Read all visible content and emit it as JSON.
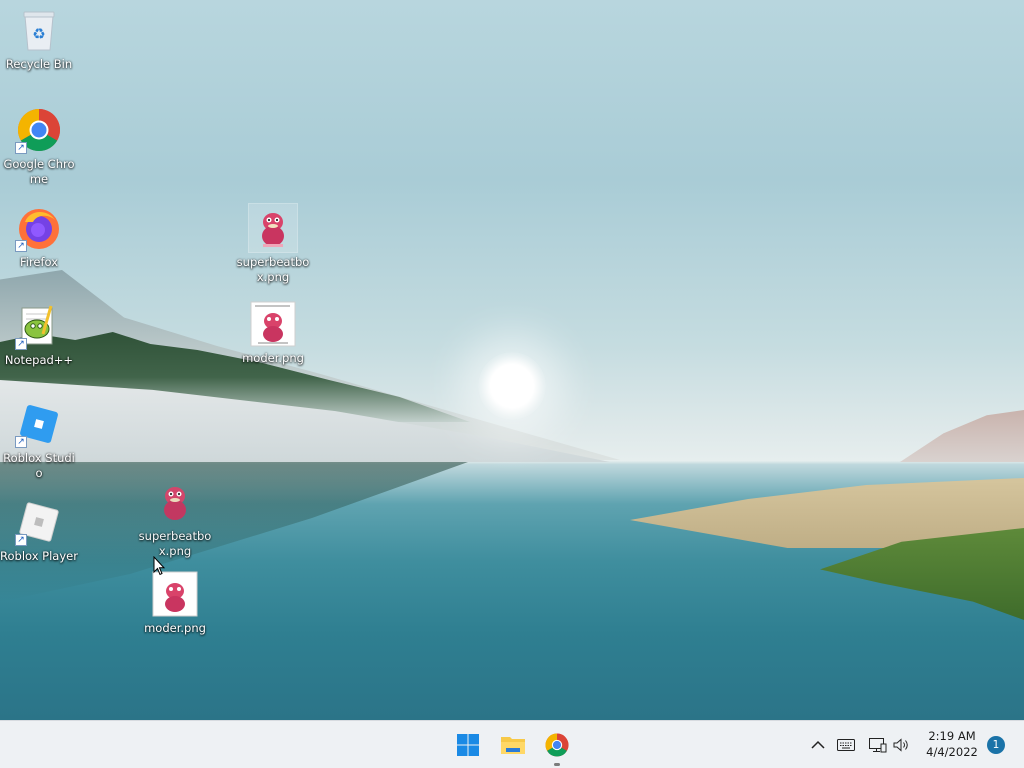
{
  "desktop": {
    "icons": [
      {
        "label": "Recycle Bin",
        "icon": "recycle-bin-icon"
      },
      {
        "label": "Google Chrome",
        "icon": "chrome-icon",
        "shortcut": true
      },
      {
        "label": "Firefox",
        "icon": "firefox-icon",
        "shortcut": true
      },
      {
        "label": "Notepad++",
        "icon": "notepad-plus-plus-icon",
        "shortcut": true
      },
      {
        "label": "Roblox Studio",
        "icon": "roblox-studio-icon",
        "shortcut": true
      },
      {
        "label": "Roblox Player",
        "icon": "roblox-player-icon",
        "shortcut": true
      },
      {
        "label": "superbeatbox.png",
        "icon": "image-file-icon"
      },
      {
        "label": "moder.png",
        "icon": "image-file-icon"
      },
      {
        "label": "superbeatbox.png",
        "icon": "image-file-icon"
      },
      {
        "label": "moder.png",
        "icon": "image-file-icon"
      }
    ]
  },
  "taskbar": {
    "apps": [
      {
        "name": "Start",
        "icon": "windows-start-icon"
      },
      {
        "name": "File Explorer",
        "icon": "folder-icon"
      },
      {
        "name": "Google Chrome",
        "icon": "chrome-icon"
      }
    ],
    "tray": {
      "icons": [
        "chevron-up-icon",
        "keyboard-icon",
        "network-icon",
        "volume-icon"
      ],
      "time": "2:19 AM",
      "date": "4/4/2022",
      "notification_count": "1"
    }
  },
  "colors": {
    "taskbar_bg": "#eef1f4",
    "accent": "#1a73a8",
    "chrome_red": "#db4437",
    "chrome_yellow": "#f4b400",
    "chrome_green": "#0f9d58",
    "chrome_blue": "#4285f4"
  }
}
